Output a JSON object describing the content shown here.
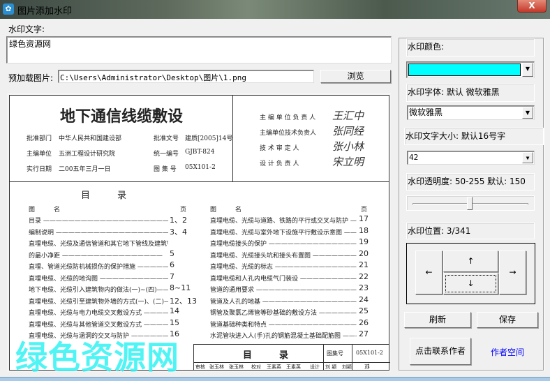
{
  "window": {
    "title": "图片添加水印",
    "close": "X",
    "icon": "✿"
  },
  "watermark_text": {
    "label": "水印文字:",
    "value": "绿色资源网"
  },
  "preload": {
    "label": "预加载图片:",
    "path": "C:\\Users\\Administrator\\Desktop\\图片\\1.png",
    "browse": "浏览"
  },
  "document": {
    "title": "地下通信线缆敷设",
    "info": [
      {
        "k": "批准部门",
        "v": "中华人民共和国建设部",
        "k2": "批准文号",
        "v2": "建质[2005]14号"
      },
      {
        "k": "主编单位",
        "v": "五洲工程设计研究院",
        "k2": "统一编号",
        "v2": "GJBT-824"
      },
      {
        "k": "实行日期",
        "v": "二00五年三月一日",
        "k2": "图 集 号",
        "v2": "05X101-2"
      }
    ],
    "roles": [
      "主 编 单 位 负 责 人",
      "主编单位技术负责人",
      "技 术 审 定 人",
      "设 计 负 责 人"
    ],
    "signatures": [
      "王汇中",
      "张同经",
      "张小林",
      "宋立明"
    ],
    "toc_title": "目　　　录",
    "col_header": {
      "name": "图　　　名",
      "page": "页"
    },
    "toc_left": [
      {
        "name": "目录 ————————————————————",
        "page": "1、2"
      },
      {
        "name": "编制说明 ——————————————————",
        "page": "3、4"
      },
      {
        "name": "直埋电缆、光缆及通信管道和其它地下管线及建筑物间",
        "page": ""
      },
      {
        "name": "的最小净距 ————————————————",
        "page": "5"
      },
      {
        "name": "直埋、管道光缆防机械损伤的保护措施 ————————",
        "page": "6"
      },
      {
        "name": "直埋电缆、光缆的地沟图 ——————————————",
        "page": "7"
      },
      {
        "name": "地下电缆、光缆引入建筑物内的做法(一)~(四)———",
        "page": "8~11"
      },
      {
        "name": "直埋电缆、光缆引至建筑物外墙的方式(一)、(二)——",
        "page": "12、13"
      },
      {
        "name": "直埋电缆、光缆与电力电缆交叉敷设方式 ————————",
        "page": "14"
      },
      {
        "name": "直埋电缆、光缆与其他管道交叉敷设方式 ————————",
        "page": "15"
      },
      {
        "name": "直埋电缆、光缆与涵洞的交叉与防护 —————————",
        "page": "16"
      }
    ],
    "toc_right": [
      {
        "name": "直埋电缆、光缆与道路、铁路的平行或交叉与防护 ————",
        "page": "17"
      },
      {
        "name": "直埋电缆、光缆与室外地下设施平行敷设示意图 —————",
        "page": "18"
      },
      {
        "name": "直埋电缆接头的保护 ————————————————",
        "page": "19"
      },
      {
        "name": "直埋电缆、光缆接头坑和接头布置图 ———————————",
        "page": "20"
      },
      {
        "name": "直埋电缆、光缆的标志 ———————————————",
        "page": "21"
      },
      {
        "name": "直埋电缆和人孔内电缆气门装设 ——————————————",
        "page": "22"
      },
      {
        "name": "管道的通用要求 ————————————————————",
        "page": "23"
      },
      {
        "name": "管道及人孔的地基 ——————————————————",
        "page": "24"
      },
      {
        "name": "钢管及聚氯乙烯管等砂基础的敷设方法 ————————",
        "page": "25"
      },
      {
        "name": "管道基础种类和特点 ——————————————————",
        "page": "26"
      },
      {
        "name": "水泥管块进入人(手)孔的钢筋混凝土基础配筋图 ————",
        "page": "27"
      }
    ],
    "titleblock": {
      "name": "目　　　录",
      "atlas_label": "图集号",
      "atlas_no": "05X101-2",
      "row": [
        "审核",
        "张玉林",
        "张玉林",
        "校对",
        "王素英",
        "王素英",
        "设计",
        "刘 颖",
        "刘颖",
        "页",
        "1"
      ]
    },
    "overlay_watermark": "绿色资源网"
  },
  "panel": {
    "color_label": "水印颜色:",
    "color_value": "#00ffff",
    "font_label": "水印字体: 默认 微软雅黑",
    "font_value": "微软雅黑",
    "size_label": "水印文字大小: 默认16号字",
    "size_value": "42",
    "opacity_label": "水印透明度: 50-255 默认: 150",
    "opacity_value": 150,
    "opacity_range": [
      50,
      255
    ],
    "position_label": "水印位置: 3/341",
    "arrows": {
      "left": "←",
      "up": "↑",
      "down": "↓",
      "right": "→"
    },
    "refresh": "刷新",
    "save": "保存",
    "contact": "点击联系作者",
    "author_link": "作者空间",
    "dropdown_arrow": "▼"
  }
}
